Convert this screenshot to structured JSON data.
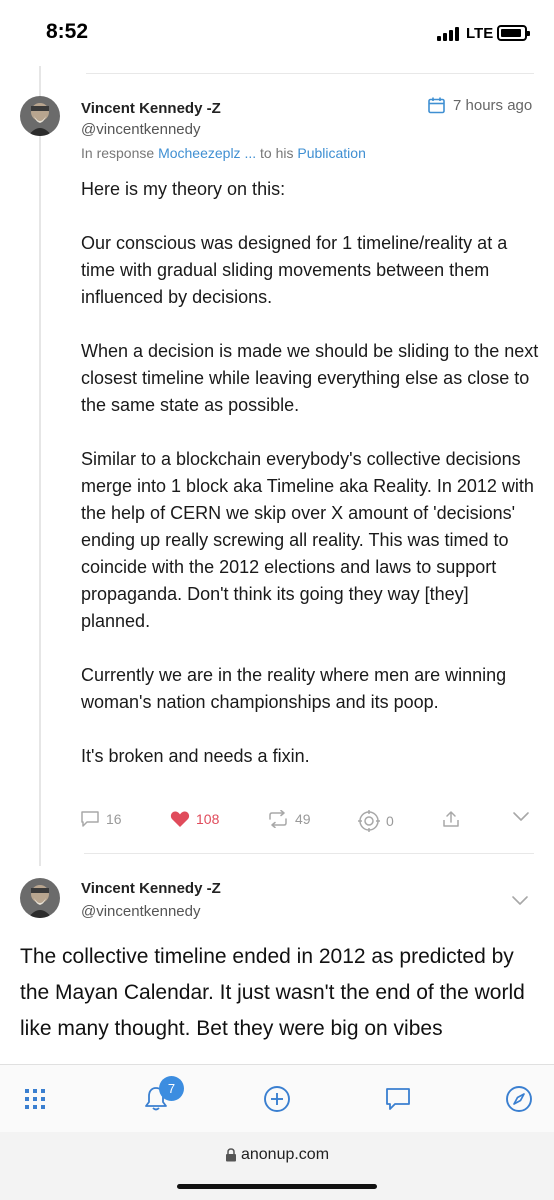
{
  "status_bar": {
    "time": "8:52",
    "network": "LTE"
  },
  "post1": {
    "author_name": "Vincent Kennedy -Z",
    "author_handle": "@vincentkennedy",
    "timestamp": "7 hours ago",
    "reply_prefix": "In response",
    "reply_user": "Mocheezeplz ...",
    "reply_middle": "to his",
    "reply_target": "Publication",
    "paragraphs": [
      "Here is my theory on this:",
      "Our conscious was designed for 1 timeline/reality at a time with gradual sliding movements between them influenced by decisions.",
      "When a decision is made we should be sliding to the next closest timeline while leaving everything else as close to the same state as possible.",
      "Similar to a blockchain everybody's collective decisions merge into 1 block aka Timeline aka Reality. In 2012 with the help of CERN we skip over X amount of 'decisions' ending up really screwing all reality. This was timed to coincide with the 2012 elections and laws to support propaganda. Don't think its going they way [they] planned.",
      "Currently we are in the reality where men are winning woman's nation championships and its poop.",
      "It's broken and needs a fixin."
    ],
    "actions": {
      "comments": "16",
      "likes": "108",
      "reposts": "49",
      "tips": "0"
    }
  },
  "post2": {
    "author_name": "Vincent Kennedy -Z",
    "author_handle": "@vincentkennedy",
    "body": "The collective timeline ended in 2012 as predicted by the Mayan Calendar. It just wasn't the end of the world like many thought. Bet they were big on vibes"
  },
  "tab_bar": {
    "notification_count": "7"
  },
  "browser": {
    "url": "anonup.com"
  },
  "colors": {
    "accent": "#3c8de0",
    "like": "#e04b5b",
    "link": "#3f8fd2"
  }
}
